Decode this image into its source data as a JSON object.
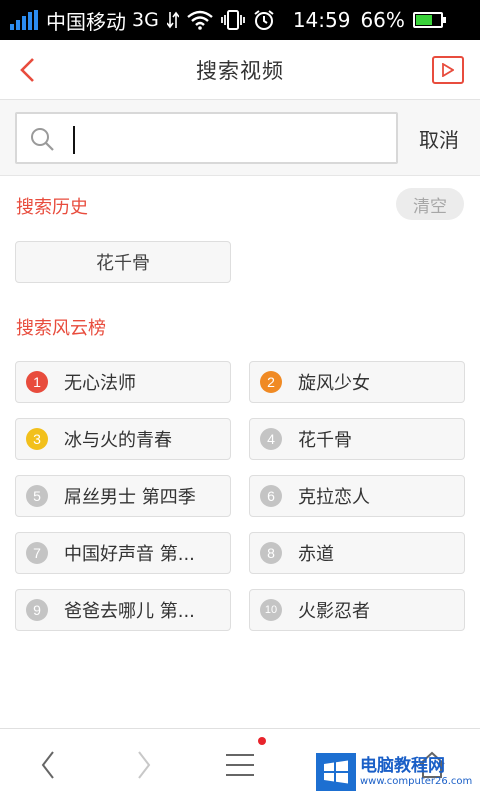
{
  "status_bar": {
    "carrier": "中国移动",
    "network": "3G",
    "time": "14:59",
    "battery": "66%",
    "battery_level": 0.66,
    "signal_color": "#2c8cf0"
  },
  "header": {
    "title": "搜索视频",
    "back_icon": "chevron-left-icon",
    "video_icon": "play-video-icon",
    "accent": "#e84c3d"
  },
  "search": {
    "value": "",
    "placeholder": "",
    "cancel_label": "取消"
  },
  "history": {
    "title": "搜索历史",
    "clear_label": "清空",
    "items": [
      "花千骨"
    ]
  },
  "trending": {
    "title": "搜索风云榜",
    "items": [
      {
        "rank": "1",
        "label": "无心法师",
        "badge_color": "#e84c3d"
      },
      {
        "rank": "2",
        "label": "旋风少女",
        "badge_color": "#f08a24"
      },
      {
        "rank": "3",
        "label": "冰与火的青春",
        "badge_color": "#f2c01c"
      },
      {
        "rank": "4",
        "label": "花千骨",
        "badge_color": "#c4c4c4"
      },
      {
        "rank": "5",
        "label": "屌丝男士 第四季",
        "badge_color": "#c4c4c4"
      },
      {
        "rank": "6",
        "label": "克拉恋人",
        "badge_color": "#c4c4c4"
      },
      {
        "rank": "7",
        "label": "中国好声音 第...",
        "badge_color": "#c4c4c4"
      },
      {
        "rank": "8",
        "label": "赤道",
        "badge_color": "#c4c4c4"
      },
      {
        "rank": "9",
        "label": "爸爸去哪儿 第...",
        "badge_color": "#c4c4c4"
      },
      {
        "rank": "10",
        "label": "火影忍者",
        "badge_color": "#c4c4c4"
      }
    ]
  },
  "watermark": {
    "main": "电脑教程网",
    "sub": "www.computer26.com"
  }
}
